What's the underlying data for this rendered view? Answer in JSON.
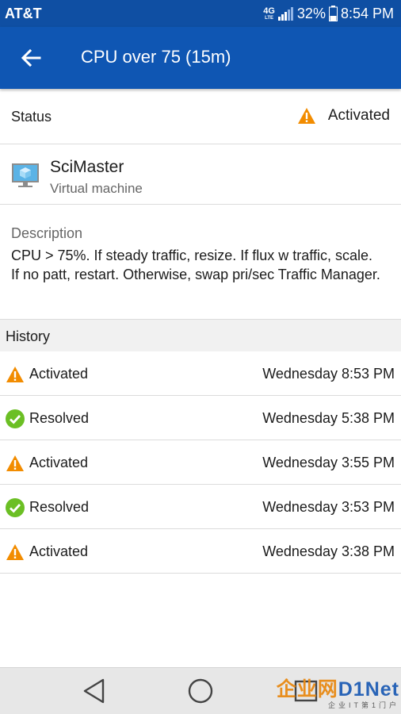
{
  "status_bar": {
    "carrier": "AT&T",
    "network": "4G",
    "network_sub": "LTE",
    "battery": "32%",
    "time": "8:54 PM"
  },
  "app_bar": {
    "title": "CPU over 75 (15m)",
    "back_icon": "arrow-left-icon"
  },
  "status": {
    "label": "Status",
    "value": "Activated",
    "icon": "warning-icon"
  },
  "resource": {
    "name": "SciMaster",
    "type": "Virtual machine",
    "icon": "virtual-machine-icon"
  },
  "description": {
    "label": "Description",
    "text": "CPU > 75%. If steady traffic, resize. If flux w traffic, scale. If no patt, restart. Otherwise, swap pri/sec Traffic Manager."
  },
  "history": {
    "label": "History",
    "items": [
      {
        "state": "Activated",
        "time": "Wednesday 8:53 PM",
        "icon": "warning-icon"
      },
      {
        "state": "Resolved",
        "time": "Wednesday 5:38 PM",
        "icon": "check-circle-icon"
      },
      {
        "state": "Activated",
        "time": "Wednesday 3:55 PM",
        "icon": "warning-icon"
      },
      {
        "state": "Resolved",
        "time": "Wednesday 3:53 PM",
        "icon": "check-circle-icon"
      },
      {
        "state": "Activated",
        "time": "Wednesday 3:38 PM",
        "icon": "warning-icon"
      }
    ]
  },
  "watermark": {
    "main_a": "企业网",
    "main_b": "D1Net",
    "sub": "企业IT第1门户"
  },
  "colors": {
    "app_bar": "#0f56b3",
    "status_bar": "#0f4fa3",
    "warning": "#f28c00",
    "resolved": "#6bbf24"
  }
}
